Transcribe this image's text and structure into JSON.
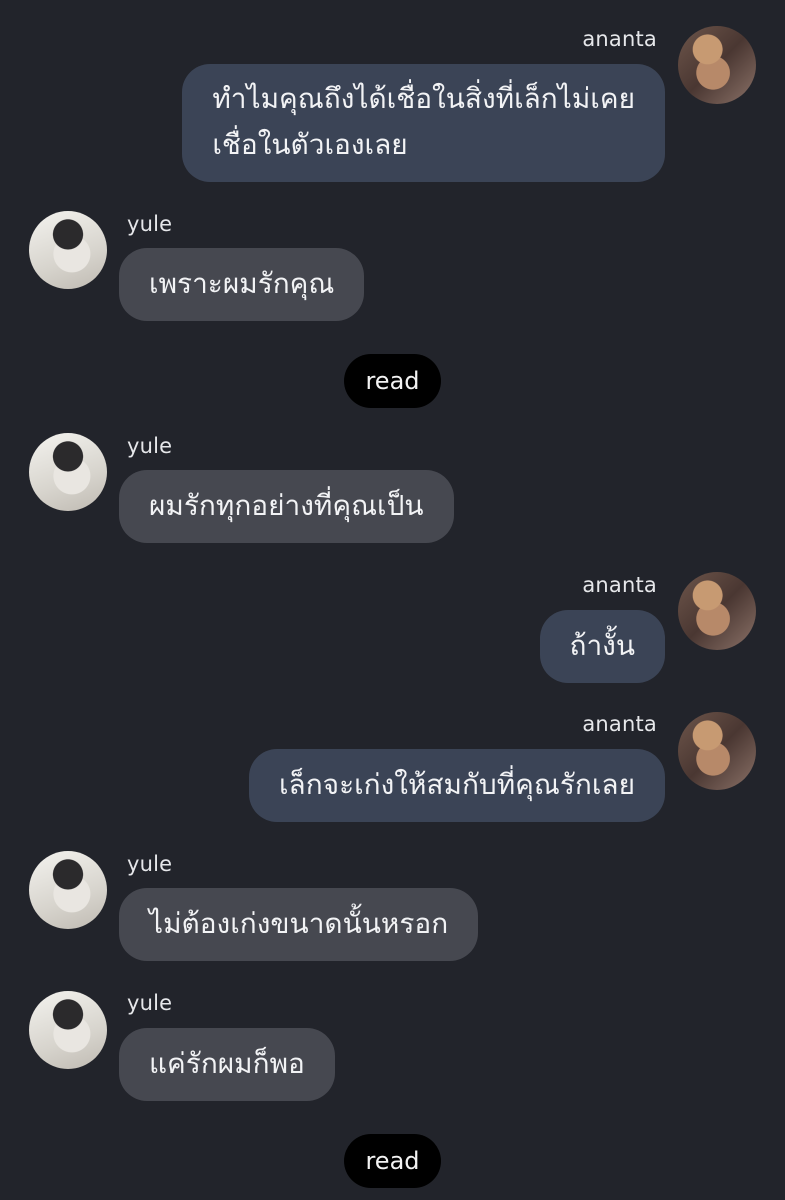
{
  "messages": [
    {
      "sender": "ananta",
      "lines": [
        "ทำไมคุณถึงได้เชื่อในสิ่งที่เล็กไม่เคย",
        "เชื่อในตัวเองเลย"
      ]
    },
    {
      "sender": "yule",
      "text": "เพราะผมรักคุณ"
    },
    {
      "status": "read"
    },
    {
      "sender": "yule",
      "text": "ผมรักทุกอย่างที่คุณเป็น"
    },
    {
      "sender": "ananta",
      "text": "ถ้างั้น"
    },
    {
      "sender": "ananta",
      "text": "เล็กจะเก่งให้สมกับที่คุณรักเลย"
    },
    {
      "sender": "yule",
      "text": "ไม่ต้องเก่งขนาดนั้นหรอก"
    },
    {
      "sender": "yule",
      "text": "แค่รักผมก็พอ"
    },
    {
      "status": "read"
    }
  ],
  "colors": {
    "background": "#22242b",
    "incoming_bubble": "#464850",
    "outgoing_bubble": "#3b4456",
    "read_badge": "#000000"
  }
}
